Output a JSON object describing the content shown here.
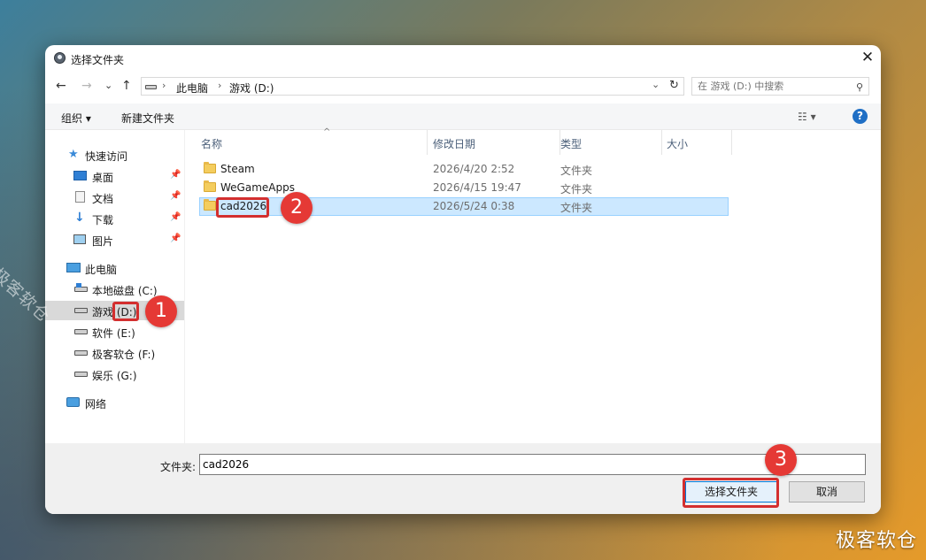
{
  "window": {
    "title": "选择文件夹",
    "close_glyph": "✕"
  },
  "nav": {
    "back": "←",
    "forward": "→",
    "recent": "⌄",
    "up": "↑"
  },
  "address": {
    "crumbs": [
      "此电脑",
      "游戏 (D:)"
    ],
    "separator": "›",
    "dropdown_glyph": "⌄",
    "refresh_glyph": "↻"
  },
  "search": {
    "placeholder": "在 游戏 (D:) 中搜索",
    "icon": "search-icon"
  },
  "toolbar": {
    "organize": "组织 ▾",
    "new_folder": "新建文件夹",
    "view_glyph": "☷ ▾",
    "help": "?"
  },
  "sidebar": {
    "quick_access": "快速访问",
    "quick_items": [
      {
        "label": "桌面",
        "icon": "desktop-icon"
      },
      {
        "label": "文档",
        "icon": "document-icon"
      },
      {
        "label": "下载",
        "icon": "download-icon"
      },
      {
        "label": "图片",
        "icon": "pictures-icon"
      }
    ],
    "pin_glyph": "📌",
    "this_pc": "此电脑",
    "drives": [
      {
        "label": "本地磁盘 (C:)"
      },
      {
        "label": "游戏 (D:)",
        "selected": true
      },
      {
        "label": "软件 (E:)"
      },
      {
        "label": "极客软仓 (F:)"
      },
      {
        "label": "娱乐 (G:)"
      }
    ],
    "network": "网络"
  },
  "columns": {
    "name": "名称",
    "modified": "修改日期",
    "type": "类型",
    "size": "大小",
    "sort_glyph": "^"
  },
  "files": [
    {
      "name": "Steam",
      "modified": "2026/4/20 2:52",
      "type": "文件夹",
      "selected": false
    },
    {
      "name": "WeGameApps",
      "modified": "2026/4/15 19:47",
      "type": "文件夹",
      "selected": false
    },
    {
      "name": "cad2026",
      "modified": "2026/5/24 0:38",
      "type": "文件夹",
      "selected": true
    }
  ],
  "footer": {
    "folder_label": "文件夹:",
    "folder_value": "cad2026",
    "select_button": "选择文件夹",
    "cancel_button": "取消"
  },
  "annotations": {
    "step1": "1",
    "step2": "2",
    "step3": "3",
    "color": "#e53935"
  },
  "watermark": {
    "diagonal": "极客软仓",
    "corner": "极客软仓"
  }
}
